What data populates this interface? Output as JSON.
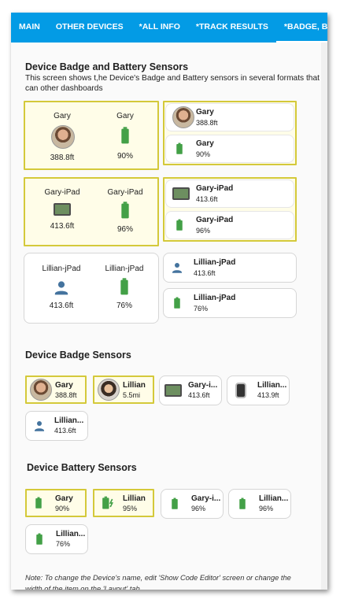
{
  "tabs": [
    "MAIN",
    "OTHER DEVICES",
    "*ALL INFO",
    "*TRACK RESULTS",
    "*BADGE, BATTERY"
  ],
  "section1": {
    "title": "Device Badge and Battery Sensors",
    "desc": "This screen shows t,he Device's Badge and Battery sensors in several formats that can other dashboards"
  },
  "grid_cards": [
    {
      "left": {
        "name": "Gary",
        "value": "388.8ft"
      },
      "right": {
        "name": "Gary",
        "value": "90%"
      }
    },
    {
      "left": {
        "name": "Gary-iPad",
        "value": "413.6ft"
      },
      "right": {
        "name": "Gary-iPad",
        "value": "96%"
      }
    },
    {
      "left": {
        "name": "Lillian-jPad",
        "value": "413.6ft"
      },
      "right": {
        "name": "Lillian-jPad",
        "value": "76%"
      }
    }
  ],
  "list_cards": [
    {
      "name": "Gary",
      "value": "388.8ft"
    },
    {
      "name": "Gary",
      "value": "90%"
    },
    {
      "name": "Gary-iPad",
      "value": "413.6ft"
    },
    {
      "name": "Gary-iPad",
      "value": "96%"
    },
    {
      "name": "Lillian-jPad",
      "value": "413.6ft"
    },
    {
      "name": "Lillian-jPad",
      "value": "76%"
    }
  ],
  "section2": {
    "title": "Device Badge Sensors"
  },
  "badge_chips": [
    {
      "name": "Gary",
      "value": "388.8ft"
    },
    {
      "name": "Lillian",
      "value": "5.5mi"
    },
    {
      "name": "Gary-i...",
      "value": "413.6ft"
    },
    {
      "name": "Lillian...",
      "value": "413.9ft"
    },
    {
      "name": "Lillian...",
      "value": "413.6ft"
    }
  ],
  "section3": {
    "title": "Device Battery Sensors"
  },
  "battery_chips": [
    {
      "name": "Gary",
      "value": "90%"
    },
    {
      "name": "Lillian",
      "value": "95%"
    },
    {
      "name": "Gary-i...",
      "value": "96%"
    },
    {
      "name": "Lillian...",
      "value": "96%"
    },
    {
      "name": "Lillian...",
      "value": "76%"
    }
  ],
  "note": "Note: To change the Device's name, edit 'Show Code Editor' screen or change the width of the item on the 'Layout' tab",
  "colors": {
    "accent": "#039be5",
    "battery": "#43a047",
    "person": "#44739e",
    "highlight_border": "#d4c93a"
  }
}
